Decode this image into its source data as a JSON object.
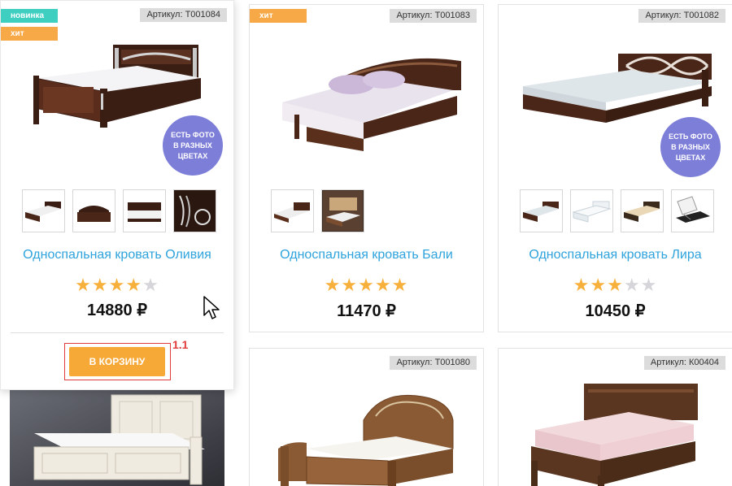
{
  "products": [
    {
      "sku": "Артикул: Т001084",
      "badges": [
        "новинка",
        "хит"
      ],
      "promo": "ЕСТЬ ФОТО В РАЗНЫХ ЦВЕТАХ",
      "title": "Односпальная кровать Оливия",
      "rating": 4,
      "price": "14880 ₽",
      "cart_label": "В КОРЗИНУ",
      "step_label": "1.1"
    },
    {
      "sku": "Артикул: Т001083",
      "badges": [
        "хит"
      ],
      "title": "Односпальная кровать Бали",
      "rating": 5,
      "price": "11470 ₽"
    },
    {
      "sku": "Артикул: Т001082",
      "promo": "ЕСТЬ ФОТО В РАЗНЫХ ЦВЕТАХ",
      "title": "Односпальная кровать Лира",
      "rating": 3,
      "price": "10450 ₽"
    },
    {
      "sku": "Артикул: Т001080"
    },
    {
      "sku": "Артикул: К00404"
    }
  ],
  "colors": {
    "title": "#2ea3dc",
    "star": "#f7b03b",
    "cart": "#f7a938",
    "badge_new": "#3ecfc0",
    "badge_hit": "#f7a948",
    "promo": "#7d7ed8",
    "highlight": "#e03a3a"
  }
}
